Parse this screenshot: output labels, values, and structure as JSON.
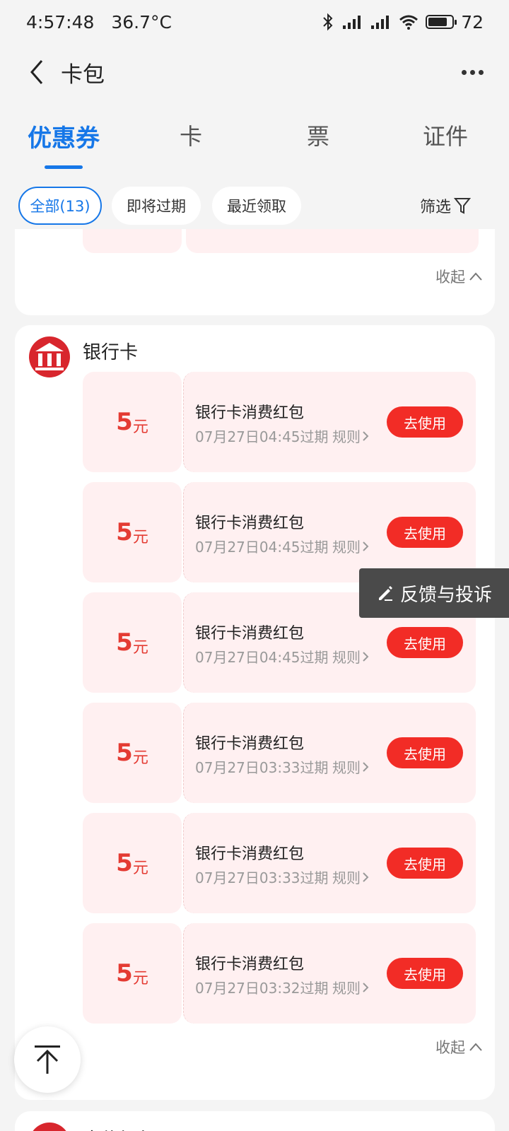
{
  "status_bar": {
    "time": "4:57:48",
    "temperature": "36.7°C",
    "battery": "72"
  },
  "header": {
    "title": "卡包"
  },
  "tabs": [
    {
      "label": "优惠券",
      "active": true
    },
    {
      "label": "卡"
    },
    {
      "label": "票"
    },
    {
      "label": "证件"
    }
  ],
  "filters": {
    "chips": [
      {
        "label": "全部(13)",
        "active": true
      },
      {
        "label": "即将过期"
      },
      {
        "label": "最近领取"
      }
    ],
    "filter_label": "筛选"
  },
  "collapse_label": "收起",
  "bank_section": {
    "name": "银行卡",
    "coupons": [
      {
        "amount": "5",
        "unit": "元",
        "title": "银行卡消费红包",
        "expiry": "07月27日04:45过期",
        "rule": "规则",
        "button": "去使用"
      },
      {
        "amount": "5",
        "unit": "元",
        "title": "银行卡消费红包",
        "expiry": "07月27日04:45过期",
        "rule": "规则",
        "button": "去使用"
      },
      {
        "amount": "5",
        "unit": "元",
        "title": "银行卡消费红包",
        "expiry": "07月27日04:45过期",
        "rule": "规则",
        "button": "去使用"
      },
      {
        "amount": "5",
        "unit": "元",
        "title": "银行卡消费红包",
        "expiry": "07月27日03:33过期",
        "rule": "规则",
        "button": "去使用"
      },
      {
        "amount": "5",
        "unit": "元",
        "title": "银行卡消费红包",
        "expiry": "07月27日03:33过期",
        "rule": "规则",
        "button": "去使用"
      },
      {
        "amount": "5",
        "unit": "元",
        "title": "银行卡消费红包",
        "expiry": "07月27日03:32过期",
        "rule": "规则",
        "button": "去使用"
      }
    ]
  },
  "next_section": {
    "name": "中信银行"
  },
  "feedback_label": "反馈与投诉",
  "colors": {
    "accent": "#1677e8",
    "coupon_red": "#e43b33",
    "button_red": "#f22c26",
    "coupon_bg": "#fff0f1"
  }
}
